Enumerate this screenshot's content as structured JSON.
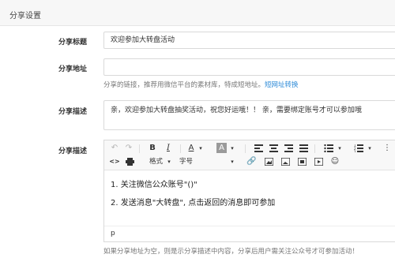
{
  "panel": {
    "title": "分享设置"
  },
  "fields": {
    "share_title": {
      "label": "分享标题",
      "value": "欢迎参加大转盘活动"
    },
    "share_url": {
      "label": "分享地址",
      "value": "",
      "help": "分享的链接，推荐用微信平台的素材库，特成短地址。",
      "help_link": "短网址转换"
    },
    "share_desc": {
      "label": "分享描述",
      "value": "亲，欢迎参加大转盘抽奖活动，祝您好运哦！！ 亲，需要绑定账号才可以参加哦"
    },
    "share_desc2": {
      "label": "分享描述",
      "editor": {
        "toolbar": {
          "undo_icon": "undo-icon",
          "redo_icon": "redo-icon",
          "bold": "B",
          "italic": "I",
          "font_color": "A",
          "bg_color": "A",
          "source": "<>",
          "format_label": "格式",
          "font_label": "字号"
        },
        "content_lines": [
          "1. 关注微信公众账号\"()\"",
          "2. 发送消息\"大转盘\", 点击返回的消息即可参加"
        ],
        "path": "p"
      },
      "help": "如果分享地址为空，则是示分享描述中内容，分享后用户需关注公众号才可参加活动！"
    }
  }
}
